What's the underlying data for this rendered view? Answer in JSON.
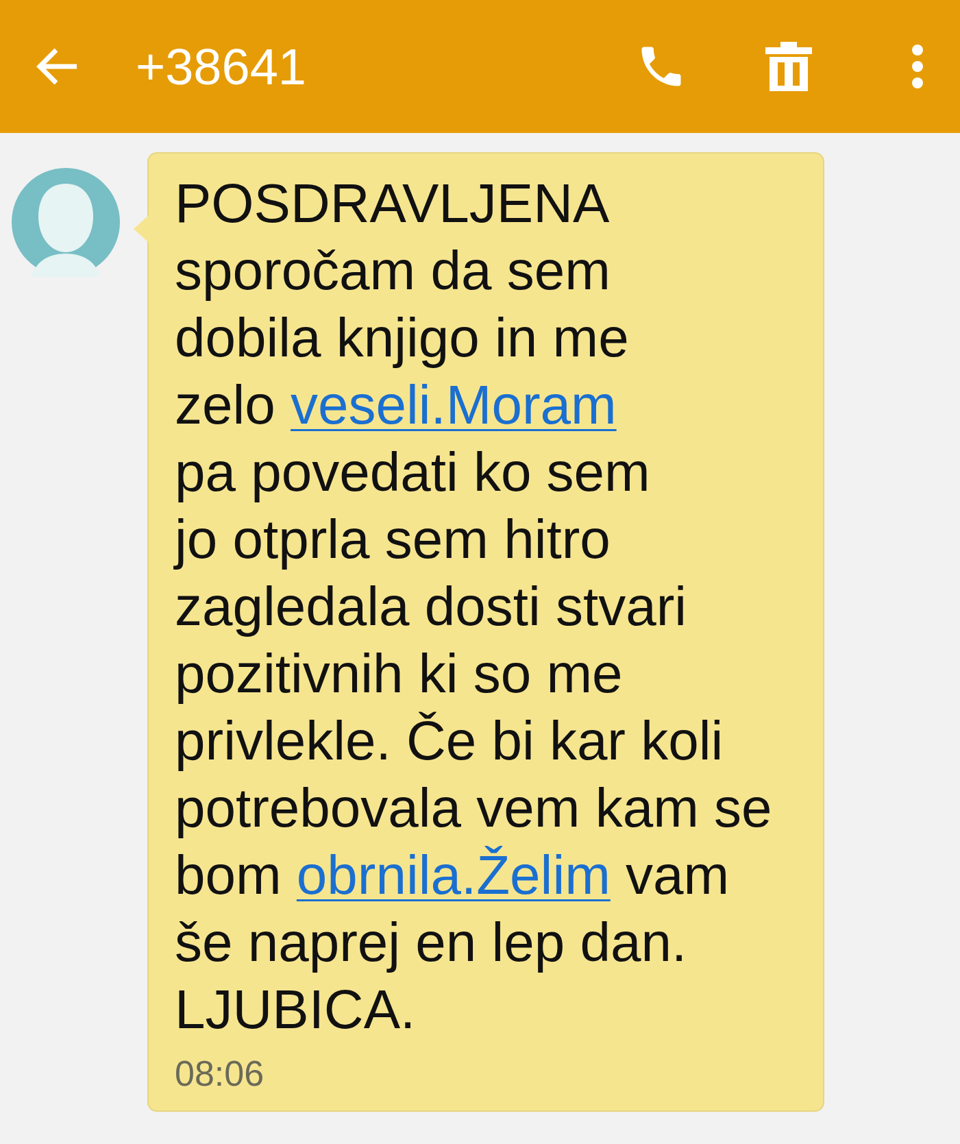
{
  "header": {
    "title": "+38641"
  },
  "messages": [
    {
      "lines": [
        [
          {
            "kind": "text",
            "text": "POSDRAVLJENA"
          }
        ],
        [
          {
            "kind": "text",
            "text": "sporočam da sem"
          }
        ],
        [
          {
            "kind": "text",
            "text": "dobila knjigo in me"
          }
        ],
        [
          {
            "kind": "text",
            "text": "zelo "
          },
          {
            "kind": "link",
            "text": "veseli.Moram"
          }
        ],
        [
          {
            "kind": "text",
            "text": "pa povedati ko sem"
          }
        ],
        [
          {
            "kind": "text",
            "text": "jo otprla sem hitro"
          }
        ],
        [
          {
            "kind": "text",
            "text": "zagledala dosti stvari"
          }
        ],
        [
          {
            "kind": "text",
            "text": "pozitivnih ki so me"
          }
        ],
        [
          {
            "kind": "text",
            "text": "privlekle. Če bi kar koli"
          }
        ],
        [
          {
            "kind": "text",
            "text": "potrebovala vem kam se"
          }
        ],
        [
          {
            "kind": "text",
            "text": "bom "
          },
          {
            "kind": "link",
            "text": "obrnila.Želim"
          },
          {
            "kind": "text",
            "text": " vam"
          }
        ],
        [
          {
            "kind": "text",
            "text": "še naprej en lep dan."
          }
        ],
        [
          {
            "kind": "text",
            "text": "LJUBICA."
          }
        ]
      ],
      "time": "08:06"
    }
  ]
}
